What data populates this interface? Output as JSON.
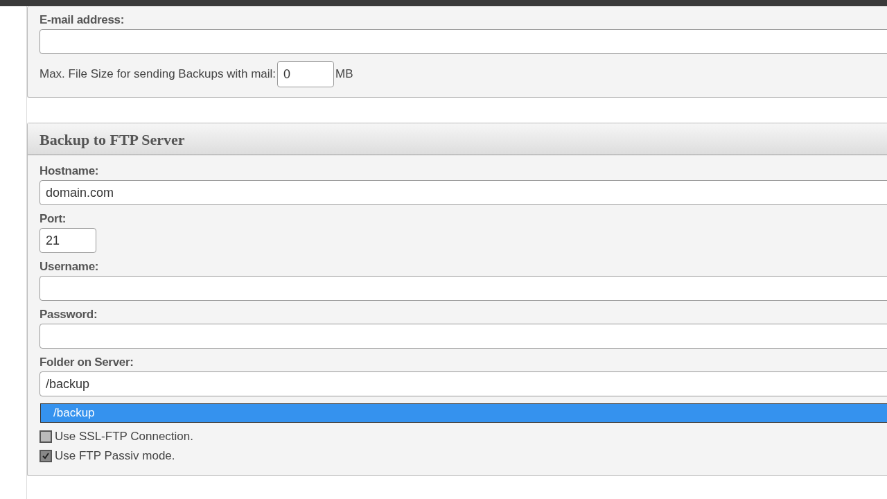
{
  "email_section": {
    "email_label": "E-mail address:",
    "max_size_label": "Max. File Size for sending Backups with mail:",
    "max_size_value": "0",
    "max_size_unit": "MB"
  },
  "ftp_section": {
    "title": "Backup to FTP Server",
    "fields": [
      {
        "label": "Hostname:",
        "value": "domain.com",
        "kind": "wide"
      },
      {
        "label": "Port:",
        "value": "21",
        "kind": "short"
      },
      {
        "label": "Username:",
        "kind": "wide"
      },
      {
        "label": "Password:",
        "kind": "wide"
      },
      {
        "label": "Folder on Server:",
        "value": "/backup",
        "kind": "wide"
      }
    ],
    "suggestions": [
      {
        "text": "/backup",
        "selected": true
      }
    ],
    "options": [
      {
        "label": "Use SSL-FTP Connection.",
        "checked": false
      },
      {
        "label": "Use FTP Passiv mode.",
        "checked": true
      }
    ]
  }
}
